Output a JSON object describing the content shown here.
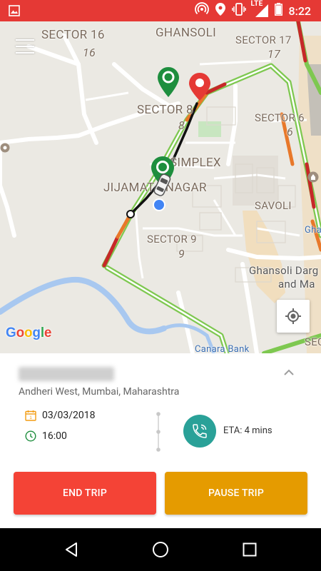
{
  "status_bar": {
    "time": "8:22",
    "network": "LTE",
    "icons": [
      "image-icon",
      "hotspot-icon",
      "location-icon",
      "vibrate-icon",
      "signal-icon",
      "battery-icon"
    ]
  },
  "map": {
    "labels": {
      "sector16": "SECTOR 16",
      "sector16_num": "16",
      "ghansoli": "GHANSOLI",
      "sector17": "SECTOR 17",
      "sector17_num": "17",
      "sector8": "SECTOR 8",
      "sector8_num": "8",
      "sector6": "SECTOR 6",
      "sector6_num": "6",
      "simplex": "SIMPLEX",
      "jijamata": "JIJAMATA NAGAR",
      "savoli": "SAVOLI",
      "sector9": "SECTOR 9",
      "sector9_num": "9",
      "ghansoli_dargah_1": "Ghansoli Darg",
      "ghansoli_dargah_2": "and Ma",
      "canara": "Canara Bank",
      "sector_edge": "SEC",
      "gha": "Gha"
    },
    "google_logo": [
      "G",
      "o",
      "o",
      "g",
      "l",
      "e"
    ],
    "colors": {
      "route_outline": "#7ec850",
      "route_traffic_slow": "#e8782a",
      "route_traffic_heavy": "#c62828",
      "driven_path": "#111111",
      "pin_green": "#1e8e3e",
      "pin_red": "#e53935"
    }
  },
  "trip": {
    "title_blurred": "Name",
    "address": "Andheri West, Mumbai, Maharashtra",
    "date": "03/03/2018",
    "time": "16:00",
    "eta": "ETA: 4 mins",
    "calendar_day": "1"
  },
  "actions": {
    "end_trip": "END TRIP",
    "pause_trip": "PAUSE TRIP"
  },
  "theme": {
    "status_bar": "#e53935",
    "end_button": "#f44336",
    "pause_button": "#e59b00",
    "call_button": "#2aa198",
    "accent_orange": "#f39c12"
  }
}
